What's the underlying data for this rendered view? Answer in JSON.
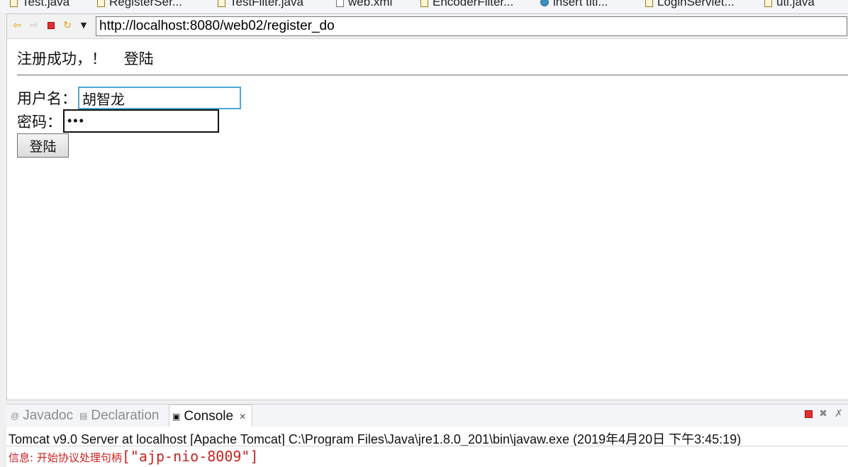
{
  "editor_tabs": [
    {
      "label": "Test.java",
      "icon": "java-file-icon"
    },
    {
      "label": "RegisterSer...",
      "icon": "java-file-icon"
    },
    {
      "label": "TestFilter.java",
      "icon": "java-file-icon"
    },
    {
      "label": "web.xml",
      "icon": "xml-file-icon"
    },
    {
      "label": "EncoderFilter...",
      "icon": "java-file-icon"
    },
    {
      "label": "insert titl...",
      "icon": "globe-icon"
    },
    {
      "label": "LoginServlet...",
      "icon": "java-file-icon"
    },
    {
      "label": "uti.java",
      "icon": "java-file-icon"
    }
  ],
  "browser": {
    "url": "http://localhost:8080/web02/register_do"
  },
  "page": {
    "success_message": "注册成功，！",
    "login_link": "登陆",
    "username_label": "用户名：",
    "username_value": "胡智龙",
    "password_label": "密码：",
    "password_value": "•••",
    "login_button": "登陆"
  },
  "console_panel": {
    "tabs": [
      {
        "label": "Javadoc",
        "icon": "at-icon"
      },
      {
        "label": "Declaration",
        "icon": "declaration-icon"
      },
      {
        "label": "Console",
        "icon": "console-icon"
      }
    ],
    "header": "Tomcat v9.0 Server at localhost [Apache Tomcat] C:\\Program Files\\Java\\jre1.8.0_201\\bin\\javaw.exe (2019年4月20日 下午3:45:19)",
    "log_prefix": "信息: 开始协议处理句柄",
    "log_value": "[\"ajp-nio-8009\"]",
    "colors": {
      "log_text": "#cc2222",
      "terminate": "#e03030"
    }
  }
}
